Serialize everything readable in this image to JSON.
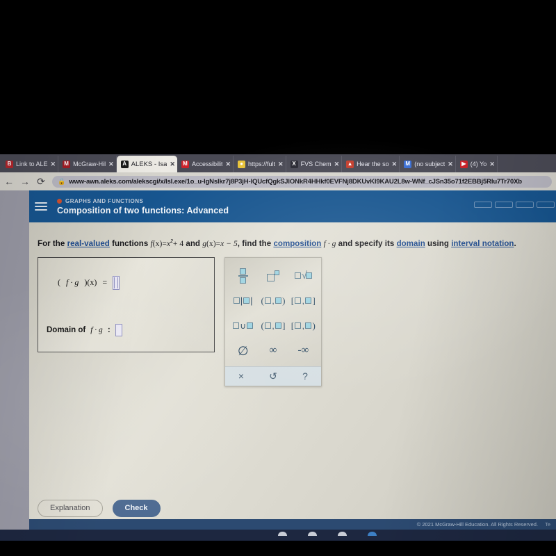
{
  "browser": {
    "tabs": [
      {
        "label": "Link to ALE",
        "favicon_letter": "B",
        "favicon_color": "#b3262c",
        "active": false,
        "close": "✕"
      },
      {
        "label": "McGraw-Hil",
        "favicon_letter": "M",
        "favicon_color": "#a31c24",
        "active": false,
        "close": "✕"
      },
      {
        "label": "ALEKS - Isa",
        "favicon_letter": "A",
        "favicon_color": "#1a1a1a",
        "active": true,
        "close": "✕"
      },
      {
        "label": "Accessibilit",
        "favicon_letter": "M",
        "favicon_color": "#cc2229",
        "active": false,
        "close": "✕"
      },
      {
        "label": "https://fult",
        "favicon_letter": "●",
        "favicon_color": "#e8c33a",
        "active": false,
        "close": "✕"
      },
      {
        "label": "FVS Chem",
        "favicon_letter": "X",
        "favicon_color": "#2a2a33",
        "active": false,
        "close": "✕"
      },
      {
        "label": "Hear the so",
        "favicon_letter": "▲",
        "favicon_color": "#c43f2e",
        "active": false,
        "close": "✕"
      },
      {
        "label": "(no subject",
        "favicon_letter": "M",
        "favicon_color": "#3b6fd4",
        "active": false,
        "close": "✕"
      },
      {
        "label": "(4) Yo",
        "favicon_letter": "▶",
        "favicon_color": "#cc2229",
        "active": false,
        "close": "✕"
      }
    ],
    "nav": {
      "back_icon": "←",
      "forward_icon": "→",
      "reload_icon": "⟳",
      "lock_icon": "🔒"
    },
    "url": "www-awn.aleks.com/alekscgi/x/lsl.exe/1o_u-IgNslkr7j8P3jH-lQUcfQgkSJlONkR4HHkf0EVFNj8DKUvKI9KAU2L8w-WNf_cJSn35o71f2EBBj5Rlu7Tr70Xb"
  },
  "aleks": {
    "eyebrow": "GRAPHS AND FUNCTIONS",
    "lesson_title": "Composition of two functions: Advanced",
    "progress_segments": 4,
    "chevron_icon": "⌄",
    "accent_color": "#17558f",
    "eyebrow_dot_color": "#d1502e"
  },
  "prompt": {
    "p1": "For the ",
    "link_real_valued": "real-valued",
    "p2": " functions ",
    "f_name": "f",
    "f_arg": "(x)",
    "eq1": "=",
    "f_body_base": "x",
    "f_body_exp": "2",
    "f_body_tail": "+ 4",
    "and": " and ",
    "g_name": "g",
    "g_arg": "(x)",
    "eq2": "=",
    "g_body": "x − 5",
    "p3": ", find the ",
    "link_composition": "composition",
    "composition_expr": "f · g",
    "p4": " and specify its ",
    "link_domain": "domain",
    "p5": " using ",
    "link_interval_notation": "interval notation",
    "p6": "."
  },
  "answer_area": {
    "equation_label_open": "(",
    "equation_label": "f · g",
    "equation_label_close": ")(x)",
    "equals": "=",
    "domain_label_prefix": "Domain of ",
    "domain_label_expr": "f · g",
    "domain_label_colon": " :",
    "answer_value": "",
    "domain_value": ""
  },
  "keypad": {
    "rows": [
      [
        {
          "name": "fraction-key",
          "label": "□/□"
        },
        {
          "name": "power-key",
          "label": "□^□"
        },
        {
          "name": "square-root-key",
          "label": "□√□"
        }
      ],
      [
        {
          "name": "absolute-value-key",
          "label": "□|□|"
        },
        {
          "name": "open-open-interval-key",
          "label": "(□,□)"
        },
        {
          "name": "closed-closed-interval-key",
          "label": "[□,□]"
        }
      ],
      [
        {
          "name": "union-key",
          "label": "□∪□"
        },
        {
          "name": "open-closed-interval-key",
          "label": "(□,□]"
        },
        {
          "name": "closed-open-interval-key",
          "label": "[□,□)"
        }
      ],
      [
        {
          "name": "empty-set-key",
          "label": "∅"
        },
        {
          "name": "infinity-key",
          "label": "∞"
        },
        {
          "name": "negative-infinity-key",
          "label": "-∞"
        }
      ]
    ],
    "toolbar": [
      {
        "name": "clear-key",
        "label": "×"
      },
      {
        "name": "undo-key",
        "label": "↺"
      },
      {
        "name": "help-key",
        "label": "?"
      }
    ]
  },
  "buttons": {
    "explanation": "Explanation",
    "check": "Check"
  },
  "footer": {
    "copyright": "© 2021 McGraw-Hill Education. All Rights Reserved.",
    "terms": "Te"
  }
}
